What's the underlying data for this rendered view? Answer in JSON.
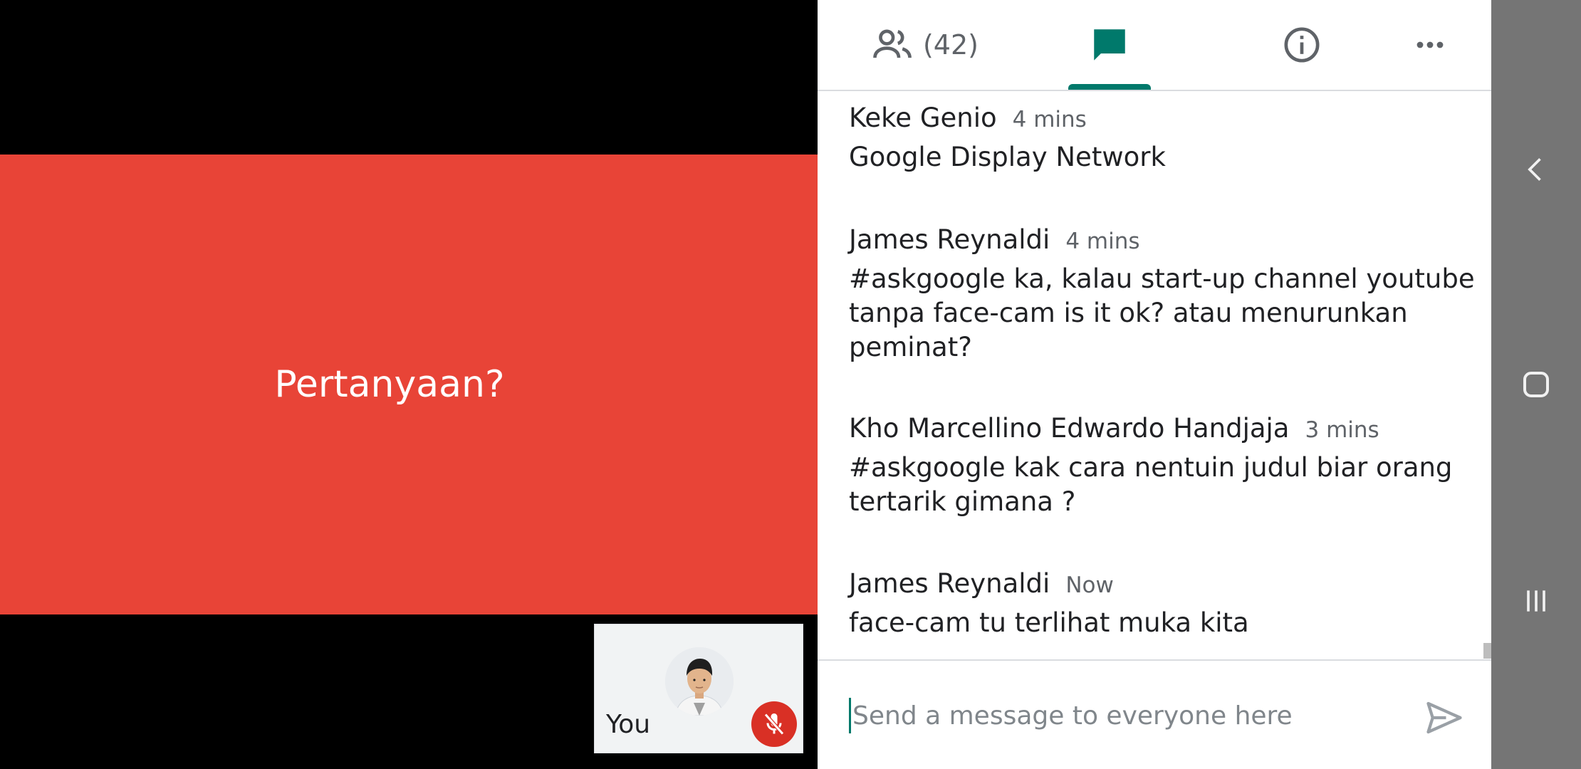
{
  "stage": {
    "slide_text": "Pertanyaan?",
    "self_label": "You"
  },
  "tabs": {
    "people_count": "(42)",
    "active": "chat"
  },
  "messages": [
    {
      "sender": "Keke Genio",
      "time": "4 mins",
      "text": "Google Display Network"
    },
    {
      "sender": "James Reynaldi",
      "time": "4 mins",
      "text": "#askgoogle ka, kalau start-up channel youtube tanpa face-cam is it ok? atau menurunkan peminat?"
    },
    {
      "sender": "Kho Marcellino Edwardo Handjaja",
      "time": "3 mins",
      "text": "#askgoogle kak cara nentuin judul biar orang tertarik gimana ?"
    },
    {
      "sender": "James Reynaldi",
      "time": "Now",
      "text": "face-cam tu terlihat muka kita"
    }
  ],
  "composer": {
    "placeholder": "Send a message to everyone here",
    "value": ""
  },
  "icons": {
    "people": "people-icon",
    "chat": "chat-icon",
    "info": "info-icon",
    "more": "more-icon",
    "mic_off": "mic-off-icon",
    "send": "send-icon",
    "nav_back": "back-icon",
    "nav_home": "home-icon",
    "nav_recents": "recents-icon"
  },
  "colors": {
    "slide_bg": "#e84437",
    "accent": "#00796b",
    "mic_off_bg": "#d93025",
    "navbar_bg": "#757575"
  }
}
